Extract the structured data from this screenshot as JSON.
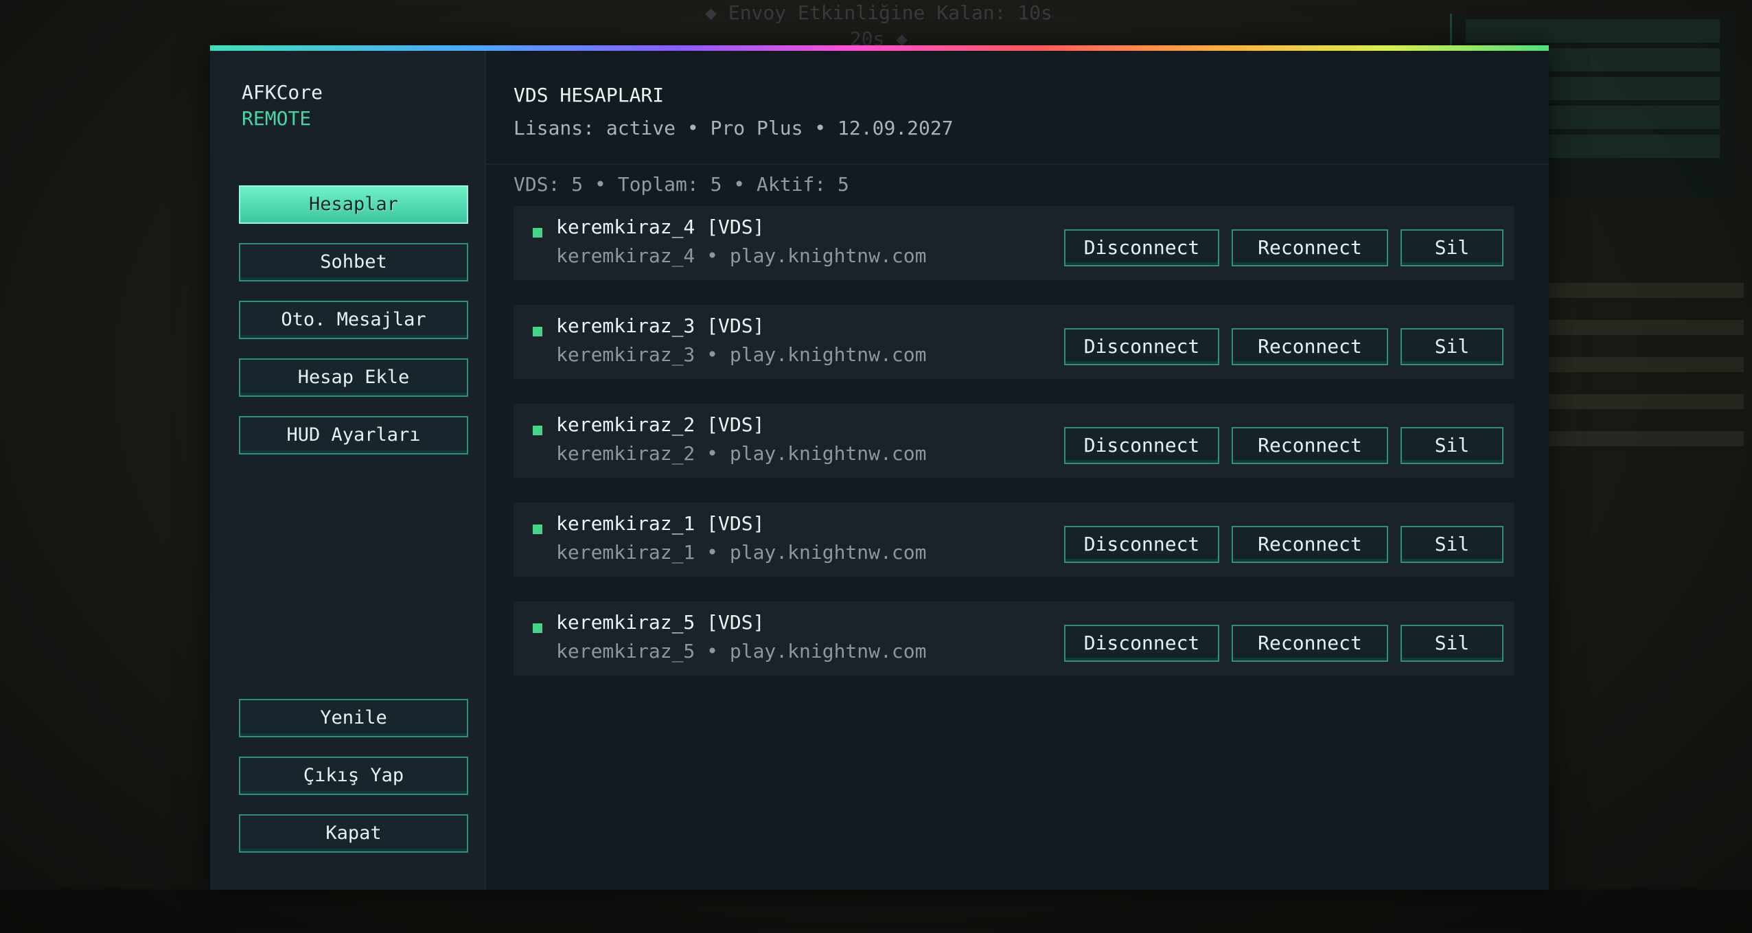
{
  "background": {
    "top_text": "◆ Envoy Etkinliğine Kalan: 10s 20s ◆"
  },
  "sidebar": {
    "brand": "AFKCore",
    "brand_sub": "REMOTE",
    "nav": [
      {
        "label": "Hesaplar",
        "active": true
      },
      {
        "label": "Sohbet"
      },
      {
        "label": "Oto. Mesajlar"
      },
      {
        "label": "Hesap Ekle"
      },
      {
        "label": "HUD Ayarları"
      }
    ],
    "bottom": [
      {
        "label": "Yenile"
      },
      {
        "label": "Çıkış Yap"
      },
      {
        "label": "Kapat"
      }
    ]
  },
  "header": {
    "title": "VDS HESAPLARI",
    "license": "Lisans: active • Pro Plus • 12.09.2027"
  },
  "stats": "VDS: 5 • Toplam: 5 • Aktif: 5",
  "accounts": [
    {
      "name": "keremkiraz_4 [VDS]",
      "sub": "keremkiraz_4 • play.knightnw.com"
    },
    {
      "name": "keremkiraz_3 [VDS]",
      "sub": "keremkiraz_3 • play.knightnw.com"
    },
    {
      "name": "keremkiraz_2 [VDS]",
      "sub": "keremkiraz_2 • play.knightnw.com"
    },
    {
      "name": "keremkiraz_1 [VDS]",
      "sub": "keremkiraz_1 • play.knightnw.com"
    },
    {
      "name": "keremkiraz_5 [VDS]",
      "sub": "keremkiraz_5 • play.knightnw.com"
    }
  ],
  "row_buttons": {
    "disconnect": "Disconnect",
    "reconnect": "Reconnect",
    "delete": "Sil"
  },
  "colors": {
    "accent": "#46d6a3",
    "online": "#43d68a",
    "panel": "#141b20"
  }
}
